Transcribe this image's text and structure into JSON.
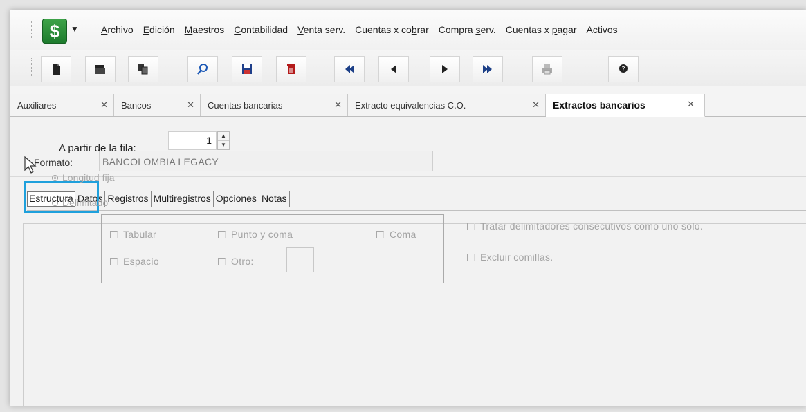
{
  "app": {
    "logo_symbol": "$",
    "dropdown_symbol": "▼",
    "accent": "#2e8b3a"
  },
  "menu": [
    {
      "label": "Archivo",
      "underline": "A"
    },
    {
      "label": "Edición",
      "underline": "E"
    },
    {
      "label": "Maestros",
      "underline": "M"
    },
    {
      "label": "Contabilidad",
      "underline": "C"
    },
    {
      "label": "Venta serv.",
      "underline": "V"
    },
    {
      "label": "Cuentas x cobrar",
      "underline": "b"
    },
    {
      "label": "Compra serv.",
      "underline": "s"
    },
    {
      "label": "Cuentas x pagar",
      "underline": "p"
    },
    {
      "label": "Activos",
      "underline": ""
    }
  ],
  "toolbar": [
    {
      "name": "new-document-icon"
    },
    {
      "name": "open-folder-icon"
    },
    {
      "name": "copy-icon"
    },
    {
      "name": "search-icon"
    },
    {
      "name": "save-icon"
    },
    {
      "name": "delete-icon"
    },
    {
      "name": "first-record-icon"
    },
    {
      "name": "previous-record-icon"
    },
    {
      "name": "next-record-icon"
    },
    {
      "name": "last-record-icon"
    },
    {
      "name": "print-icon"
    },
    {
      "name": "help-icon"
    }
  ],
  "doc_tabs": [
    {
      "label": "Auxiliares",
      "close": "✕"
    },
    {
      "label": "Bancos",
      "close": "✕"
    },
    {
      "label": "Cuentas bancarias",
      "close": "✕"
    },
    {
      "label": "Extracto equivalencias C.O.",
      "close": "✕"
    },
    {
      "label": "Extractos bancarios",
      "close": "✕",
      "active": true
    }
  ],
  "form": {
    "formato_label": "Formato:",
    "formato_value": "BANCOLOMBIA LEGACY"
  },
  "sub_tabs": [
    "Estructura",
    "Datos",
    "Registros",
    "Multiregistros",
    "Opciones",
    "Notas"
  ],
  "estructura": {
    "a_partir_label": "A partir de la fila:",
    "a_partir_value": "1",
    "radio_longitud": "Longitud fija",
    "radio_delimitado": "Delimitado",
    "chk_tabular": "Tabular",
    "chk_punto_coma": "Punto y coma",
    "chk_coma": "Coma",
    "chk_espacio": "Espacio",
    "chk_otro": "Otro:",
    "chk_consecutivos": "Tratar delimitadores consecutivos como uno solo.",
    "chk_comillas": "Excluir comillas."
  }
}
